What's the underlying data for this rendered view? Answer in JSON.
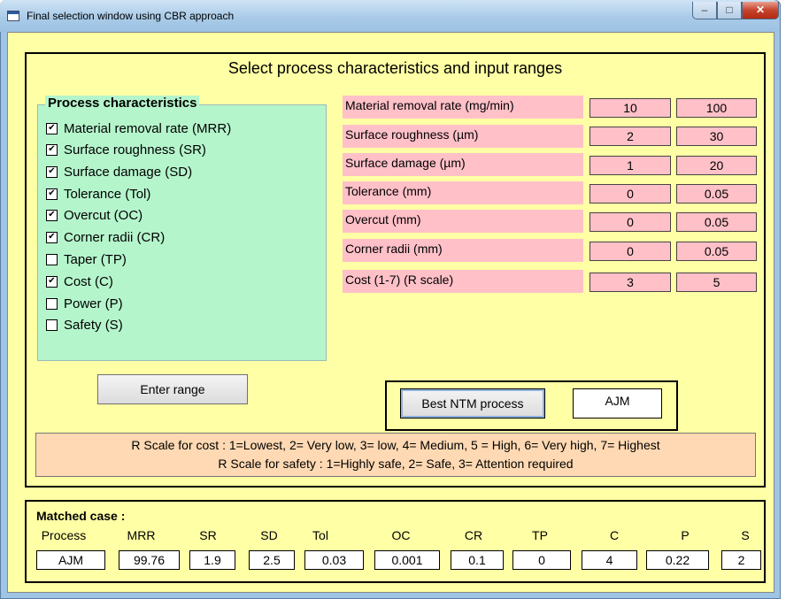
{
  "window": {
    "title": "Final selection window using CBR approach"
  },
  "heading": "Select process characteristics and input ranges",
  "process_characteristics": {
    "title": "Process characteristics",
    "items": [
      {
        "label": "Material removal rate (MRR)",
        "checked": true
      },
      {
        "label": "Surface roughness (SR)",
        "checked": true
      },
      {
        "label": "Surface damage (SD)",
        "checked": true
      },
      {
        "label": "Tolerance (Tol)",
        "checked": true
      },
      {
        "label": "Overcut (OC)",
        "checked": true
      },
      {
        "label": "Corner radii (CR)",
        "checked": true
      },
      {
        "label": "Taper (TP)",
        "checked": false
      },
      {
        "label": "Cost (C)",
        "checked": true
      },
      {
        "label": "Power (P)",
        "checked": false
      },
      {
        "label": "Safety (S)",
        "checked": false
      }
    ]
  },
  "ranges": [
    {
      "label": "Material removal rate (mg/min)",
      "min": "10",
      "max": "100"
    },
    {
      "label": "Surface roughness (µm)",
      "min": "2",
      "max": "30"
    },
    {
      "label": "Surface damage (µm)",
      "min": "1",
      "max": "20"
    },
    {
      "label": "Tolerance (mm)",
      "min": "0",
      "max": "0.05"
    },
    {
      "label": "Overcut (mm)",
      "min": "0",
      "max": "0.05"
    },
    {
      "label": "Corner radii (mm)",
      "min": "0",
      "max": "0.05"
    },
    {
      "label": "Cost (1-7) (R scale)",
      "min": "3",
      "max": "5"
    }
  ],
  "buttons": {
    "enter_range": "Enter range",
    "best_ntm": "Best NTM process"
  },
  "best_process": "AJM",
  "notes": {
    "cost": "R Scale for cost : 1=Lowest, 2= Very low, 3= low, 4= Medium, 5 = High, 6= Very high, 7= Highest",
    "safety": "R Scale for safety : 1=Highly safe, 2= Safe, 3= Attention required"
  },
  "matched_case": {
    "title": "Matched case :",
    "headers": [
      "Process",
      "MRR",
      "SR",
      "SD",
      "Tol",
      "OC",
      "CR",
      "TP",
      "C",
      "P",
      "S"
    ],
    "values": [
      "AJM",
      "99.76",
      "1.9",
      "2.5",
      "0.03",
      "0.001",
      "0.1",
      "0",
      "4",
      "0.22",
      "2"
    ]
  },
  "colors": {
    "client_bg": "#ffffa5",
    "group_bg": "#b5f5cc",
    "param_bg": "#ffc0c8",
    "note_bg": "#ffd9b3"
  }
}
